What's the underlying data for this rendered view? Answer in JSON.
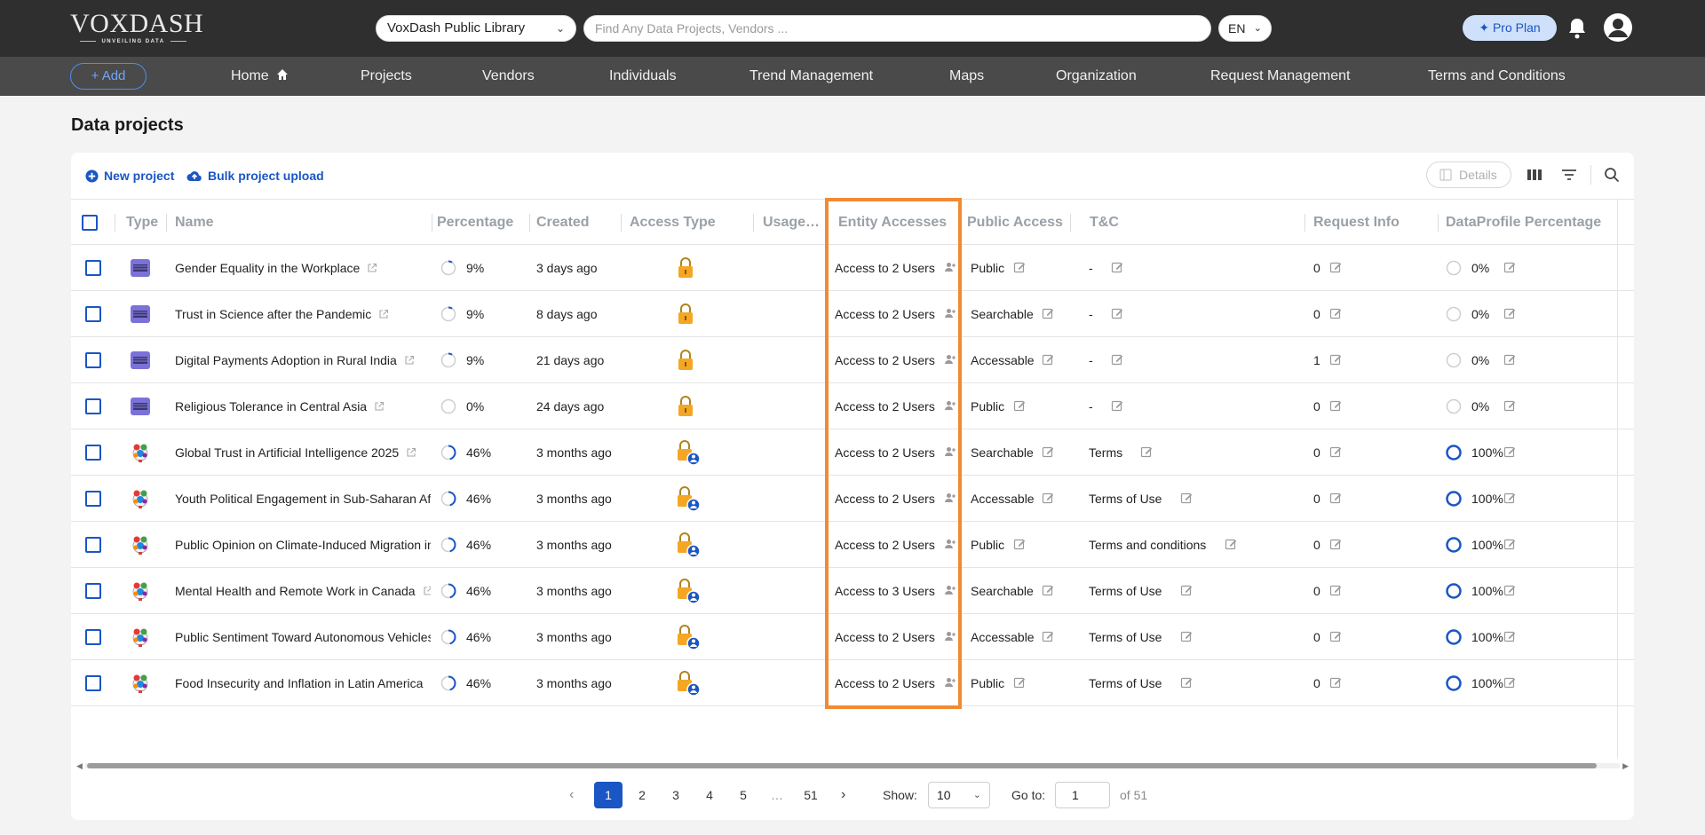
{
  "brand": {
    "name": "VoxDash",
    "tagline": "UNVEILING DATA"
  },
  "header": {
    "library": "VoxDash Public Library",
    "search_placeholder": "Find Any Data Projects, Vendors ...",
    "language": "EN",
    "plan": "Pro Plan"
  },
  "nav": {
    "add_label": "Add",
    "items": [
      "Home",
      "Projects",
      "Vendors",
      "Individuals",
      "Trend Management",
      "Maps",
      "Organization",
      "Request Management",
      "Terms and Conditions"
    ]
  },
  "page": {
    "title": "Data projects"
  },
  "toolbar": {
    "new_project": "New project",
    "bulk_upload": "Bulk project upload",
    "details": "Details"
  },
  "table": {
    "columns": [
      "Type",
      "Name",
      "Percentage",
      "Created",
      "Access Type",
      "Usage…",
      "Entity Accesses",
      "Public Access",
      "T&C",
      "Request Info",
      "DataProfile Percentage"
    ],
    "rows": [
      {
        "type": "survey",
        "name": "Gender Equality in the Workplace",
        "percentage": "9%",
        "pct_value": 0.09,
        "created": "3 days ago",
        "access": "lock",
        "entity": "Access to 2 Users",
        "public": "Public",
        "tc": "-",
        "request": "0",
        "profile": "0%",
        "profile_value": 0
      },
      {
        "type": "survey",
        "name": "Trust in Science after the Pandemic",
        "percentage": "9%",
        "pct_value": 0.09,
        "created": "8 days ago",
        "access": "lock",
        "entity": "Access to 2 Users",
        "public": "Searchable",
        "tc": "-",
        "request": "0",
        "profile": "0%",
        "profile_value": 0
      },
      {
        "type": "survey",
        "name": "Digital Payments Adoption in Rural India",
        "percentage": "9%",
        "pct_value": 0.09,
        "created": "21 days ago",
        "access": "lock",
        "entity": "Access to 2 Users",
        "public": "Accessable",
        "tc": "-",
        "request": "1",
        "profile": "0%",
        "profile_value": 0
      },
      {
        "type": "survey",
        "name": "Religious Tolerance in Central Asia",
        "percentage": "0%",
        "pct_value": 0,
        "created": "24 days ago",
        "access": "lock",
        "entity": "Access to 2 Users",
        "public": "Public",
        "tc": "-",
        "request": "0",
        "profile": "0%",
        "profile_value": 0
      },
      {
        "type": "globe",
        "name": "Global Trust in Artificial Intelligence 2025",
        "percentage": "46%",
        "pct_value": 0.46,
        "created": "3 months ago",
        "access": "lock-user",
        "entity": "Access to 2 Users",
        "public": "Searchable",
        "tc": "Terms",
        "request": "0",
        "profile": "100%",
        "profile_value": 1
      },
      {
        "type": "globe",
        "name": "Youth Political Engagement in Sub-Saharan Afi",
        "percentage": "46%",
        "pct_value": 0.46,
        "created": "3 months ago",
        "access": "lock-user",
        "entity": "Access to 2 Users",
        "public": "Accessable",
        "tc": "Terms of Use",
        "request": "0",
        "profile": "100%",
        "profile_value": 1
      },
      {
        "type": "globe",
        "name": "Public Opinion on Climate-Induced Migration in",
        "percentage": "46%",
        "pct_value": 0.46,
        "created": "3 months ago",
        "access": "lock-user",
        "entity": "Access to 2 Users",
        "public": "Public",
        "tc": "Terms and conditions",
        "request": "0",
        "profile": "100%",
        "profile_value": 1
      },
      {
        "type": "globe",
        "name": "Mental Health and Remote Work in Canada",
        "percentage": "46%",
        "pct_value": 0.46,
        "created": "3 months ago",
        "access": "lock-user",
        "entity": "Access to 3 Users",
        "public": "Searchable",
        "tc": "Terms of Use",
        "request": "0",
        "profile": "100%",
        "profile_value": 1
      },
      {
        "type": "globe",
        "name": "Public Sentiment Toward Autonomous Vehicles",
        "percentage": "46%",
        "pct_value": 0.46,
        "created": "3 months ago",
        "access": "lock-user",
        "entity": "Access to 2 Users",
        "public": "Accessable",
        "tc": "Terms of Use",
        "request": "0",
        "profile": "100%",
        "profile_value": 1
      },
      {
        "type": "globe",
        "name": "Food Insecurity and Inflation in Latin America",
        "percentage": "46%",
        "pct_value": 0.46,
        "created": "3 months ago",
        "access": "lock-user",
        "entity": "Access to 2 Users",
        "public": "Public",
        "tc": "Terms of Use",
        "request": "0",
        "profile": "100%",
        "profile_value": 1
      }
    ]
  },
  "pagination": {
    "pages": [
      "1",
      "2",
      "3",
      "4",
      "5",
      "…",
      "51"
    ],
    "current": "1",
    "show_label": "Show:",
    "show_value": "10",
    "goto_label": "Go to:",
    "goto_value": "1",
    "of_label": "of 51"
  },
  "colors": {
    "accent": "#1a56c4",
    "highlight": "#f18a32",
    "lock": "#f5a623"
  }
}
